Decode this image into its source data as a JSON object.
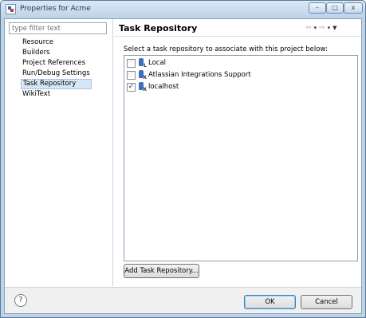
{
  "window": {
    "title": "Properties for Acme",
    "min_glyph": "–",
    "max_glyph": "□",
    "close_glyph": "x"
  },
  "sidebar": {
    "filter_placeholder": "type filter text",
    "items": [
      {
        "label": "Resource"
      },
      {
        "label": "Builders"
      },
      {
        "label": "Project References"
      },
      {
        "label": "Run/Debug Settings"
      },
      {
        "label": "Task Repository",
        "selected": true
      },
      {
        "label": "WikiText"
      }
    ]
  },
  "main": {
    "title": "Task Repository",
    "nav": {
      "back_glyph": "⇦",
      "forward_glyph": "⇨",
      "dropdown_glyph": "▾",
      "menu_glyph": "▼"
    },
    "instruction": "Select a task repository to associate with this project below:",
    "repositories": [
      {
        "label": "Local",
        "checked": false,
        "badge": "L"
      },
      {
        "label": "Atlassian Integrations Support",
        "checked": false,
        "badge": "X"
      },
      {
        "label": "localhost",
        "checked": true,
        "badge": "X"
      }
    ],
    "add_button": "Add Task Repository..."
  },
  "footer": {
    "help_glyph": "?",
    "ok": "OK",
    "cancel": "Cancel"
  },
  "icons": {
    "app": "eclipse-properties-icon",
    "repo": "task-repository-icon",
    "help": "help-icon"
  }
}
